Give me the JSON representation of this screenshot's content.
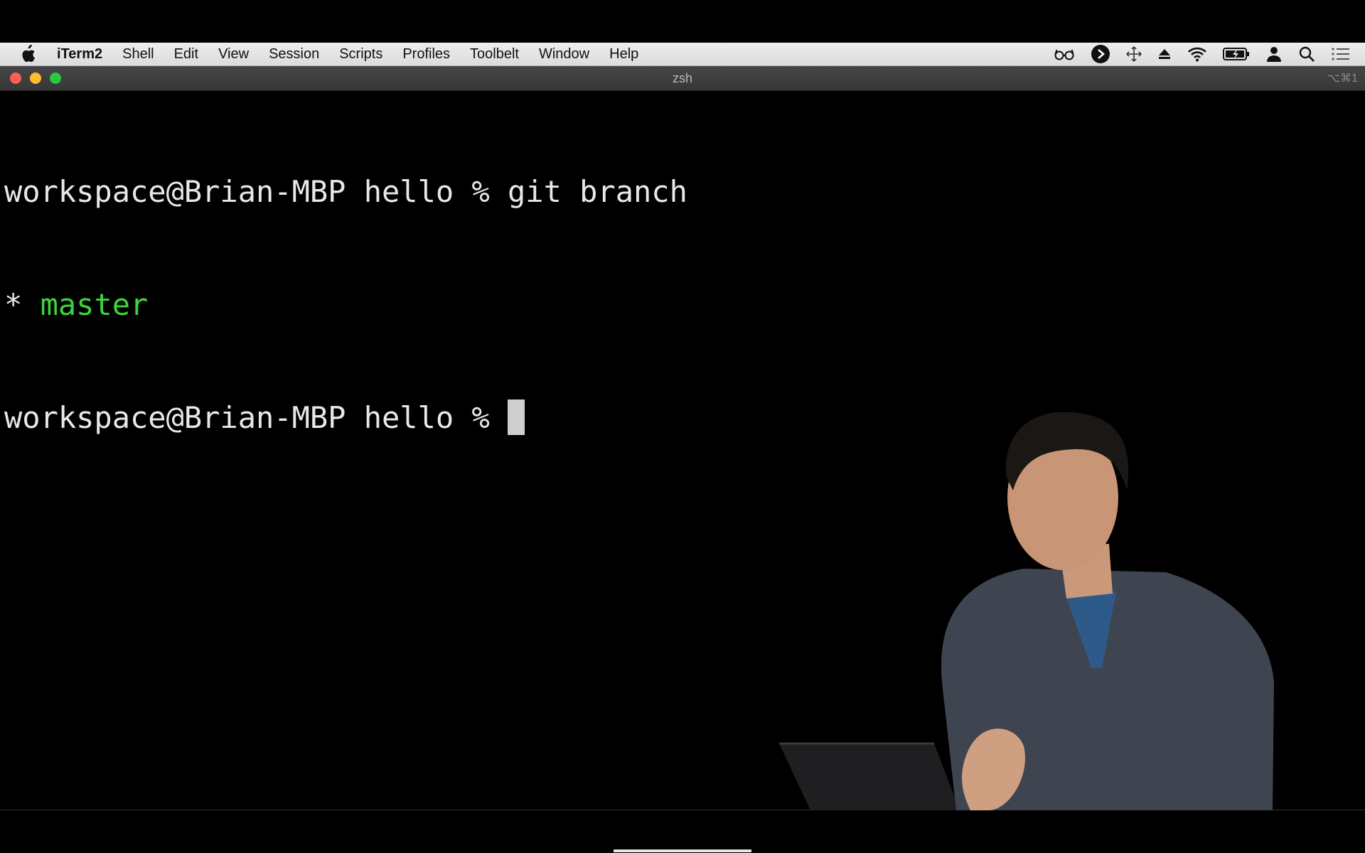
{
  "menubar": {
    "apple_icon": "apple-logo-icon",
    "app_name": "iTerm2",
    "items": [
      "Shell",
      "Edit",
      "View",
      "Session",
      "Scripts",
      "Profiles",
      "Toolbelt",
      "Window",
      "Help"
    ],
    "status_icons": [
      "glasses-icon",
      "play-circle-icon",
      "move-arrows-icon",
      "eject-icon",
      "wifi-icon",
      "battery-charging-icon",
      "user-icon",
      "search-icon",
      "list-icon"
    ]
  },
  "window": {
    "title": "zsh",
    "shortcut": "⌥⌘1"
  },
  "terminal": {
    "line1_prompt": "workspace@Brian-MBP hello % ",
    "line1_command": "git branch",
    "line2_marker": "* ",
    "line2_branch": "master",
    "line3_prompt": "workspace@Brian-MBP hello % "
  },
  "colors": {
    "branch_green": "#3bd63b",
    "text": "#e8e8e8",
    "background": "#000000"
  }
}
